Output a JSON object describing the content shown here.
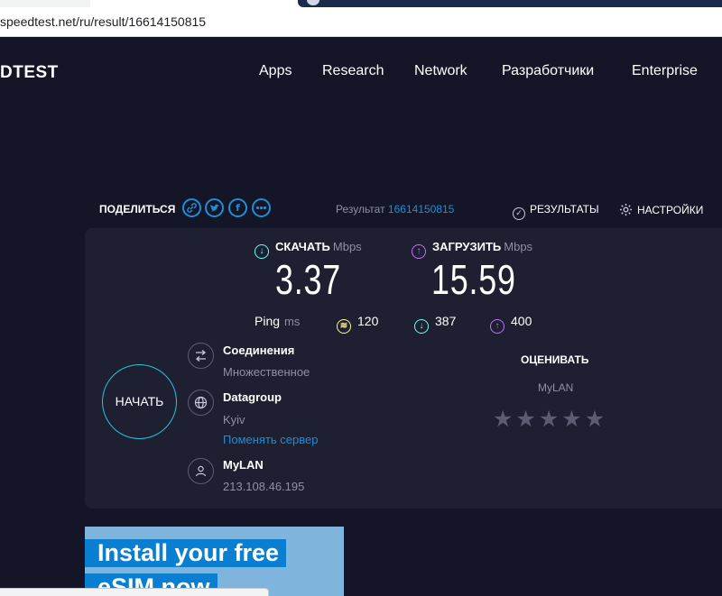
{
  "browser": {
    "url": "speedtest.net/ru/result/16614150815"
  },
  "nav": {
    "logo": "DTEST",
    "items": [
      "Apps",
      "Research",
      "Network",
      "Разработчики",
      "Enterprise"
    ]
  },
  "result_header": {
    "share_label": "ПОДЕЛИТЬСЯ",
    "share_icons": [
      "link-icon",
      "twitter-icon",
      "facebook-icon",
      "more-icon"
    ],
    "result_label": "Результат",
    "result_id": "16614150815",
    "results_link": "РЕЗУЛЬТАТЫ",
    "settings_link": "НАСТРОЙКИ"
  },
  "download": {
    "label": "СКАЧАТЬ",
    "unit": "Mbps",
    "value": "3.37"
  },
  "upload": {
    "label": "ЗАГРУЗИТЬ",
    "unit": "Mbps",
    "value": "15.59"
  },
  "ping": {
    "label": "Ping",
    "unit": "ms",
    "idle": "120",
    "download": "387",
    "upload": "400"
  },
  "go_button": "НАЧАТЬ",
  "connections": {
    "title": "Соединения",
    "value": "Множественное"
  },
  "server": {
    "name": "Datagroup",
    "location": "Kyiv",
    "change_link": "Поменять сервер"
  },
  "provider": {
    "name": "MyLAN",
    "ip": "213.108.46.195"
  },
  "rating": {
    "title": "ОЦЕНИВАТЬ",
    "isp": "MyLAN",
    "stars": 5
  },
  "ad": {
    "line1": "Install your free",
    "line2": "eSIM now"
  },
  "colors": {
    "background": "#141526",
    "panel": "#1e1f31",
    "accent_blue": "#1c8fdb",
    "download_cyan": "#6afff3",
    "upload_purple": "#bf71ff",
    "ping_yellow": "#fff7a0"
  }
}
